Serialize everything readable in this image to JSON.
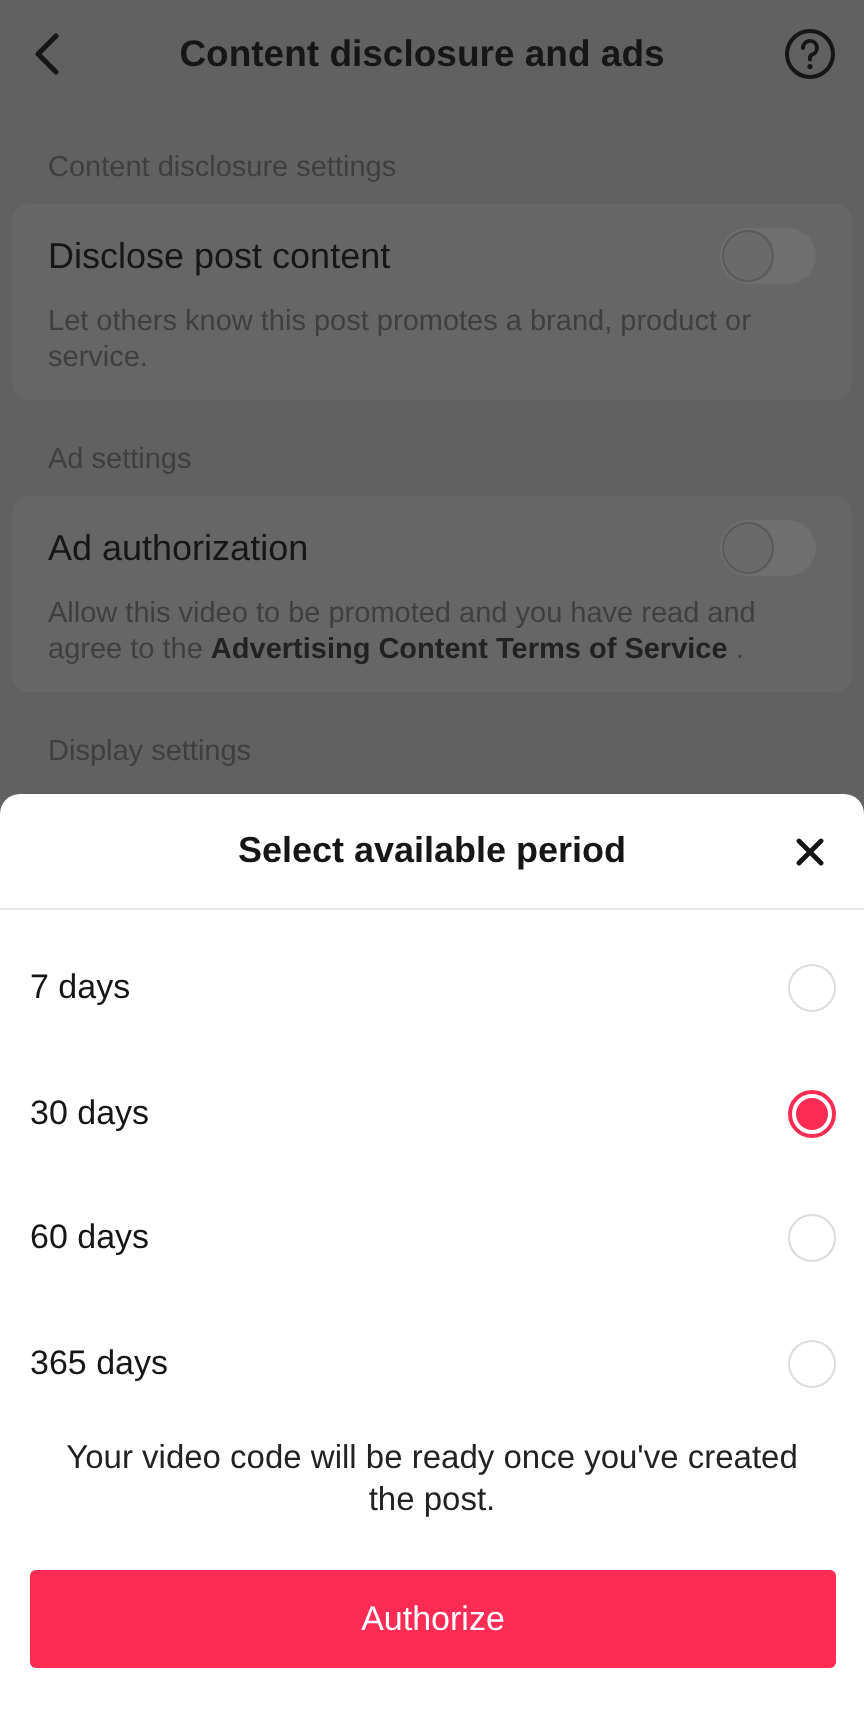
{
  "header": {
    "title": "Content disclosure and ads"
  },
  "sections": [
    {
      "label": "Content disclosure settings",
      "card": {
        "title": "Disclose post content",
        "on": false,
        "description": "Let others know this post promotes a brand, product or service."
      }
    },
    {
      "label": "Ad settings",
      "card": {
        "title": "Ad authorization",
        "on": false,
        "description": "Allow this video to be promoted and you have read and agree to the **Advertising Content Terms of Service** ."
      }
    },
    {
      "label": "Display settings"
    }
  ],
  "sheet": {
    "title": "Select available period",
    "options": [
      {
        "label": "7 days",
        "selected": false
      },
      {
        "label": "30 days",
        "selected": true
      },
      {
        "label": "60 days",
        "selected": false
      },
      {
        "label": "365 days",
        "selected": false
      }
    ],
    "note": "Your video code will be ready once you've created the post.",
    "button": "Authorize"
  }
}
